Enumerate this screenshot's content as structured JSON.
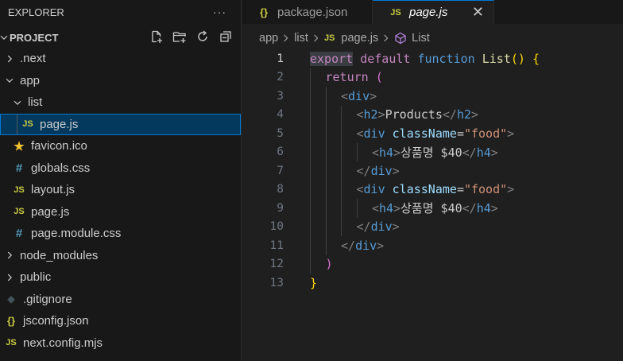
{
  "sidebar": {
    "title": "EXPLORER",
    "more": "···",
    "project": "PROJECT",
    "items": [
      {
        "label": ".next",
        "kind": "folder-closed",
        "depth": 0
      },
      {
        "label": "app",
        "kind": "folder-open",
        "depth": 0
      },
      {
        "label": "list",
        "kind": "folder-open",
        "depth": 1
      },
      {
        "label": "page.js",
        "kind": "js",
        "icon": "JS",
        "depth": 2,
        "selected": true
      },
      {
        "label": "favicon.ico",
        "kind": "star",
        "depth": 1
      },
      {
        "label": "globals.css",
        "kind": "css",
        "icon": "#",
        "depth": 1
      },
      {
        "label": "layout.js",
        "kind": "js",
        "icon": "JS",
        "depth": 1
      },
      {
        "label": "page.js",
        "kind": "js",
        "icon": "JS",
        "depth": 1
      },
      {
        "label": "page.module.css",
        "kind": "css",
        "icon": "#",
        "depth": 1
      },
      {
        "label": "node_modules",
        "kind": "folder-closed",
        "depth": 0
      },
      {
        "label": "public",
        "kind": "folder-closed",
        "depth": 0
      },
      {
        "label": ".gitignore",
        "kind": "git",
        "icon": "◆",
        "depth": 0
      },
      {
        "label": "jsconfig.json",
        "kind": "json",
        "icon": "{}",
        "depth": 0
      },
      {
        "label": "next.config.mjs",
        "kind": "js",
        "icon": "JS",
        "depth": 0
      }
    ]
  },
  "tabs": [
    {
      "label": "package.json",
      "icon": "{}",
      "active": false
    },
    {
      "label": "page.js",
      "icon": "JS",
      "active": true,
      "close": "✕"
    }
  ],
  "breadcrumb": [
    "app",
    "list",
    "page.js",
    "List"
  ],
  "breadcrumb_icons": {
    "js": "JS"
  },
  "code": {
    "line_numbers": [
      "1",
      "2",
      "3",
      "4",
      "5",
      "6",
      "7",
      "8",
      "9",
      "10",
      "11",
      "12",
      "13"
    ],
    "current_line": 1,
    "lines": [
      {
        "t": [
          [
            "k-ctl",
            "export"
          ],
          [
            "k-txt",
            " "
          ],
          [
            "k-ctl",
            "default"
          ],
          [
            "k-txt",
            " "
          ],
          [
            "k-kw",
            "function"
          ],
          [
            "k-txt",
            " "
          ],
          [
            "k-fn",
            "List"
          ],
          [
            "k-br1",
            "()"
          ],
          [
            "k-txt",
            " "
          ],
          [
            "k-br1",
            "{"
          ]
        ],
        "indent": 0
      },
      {
        "t": [
          [
            "k-ctl",
            "return"
          ],
          [
            "k-txt",
            " "
          ],
          [
            "k-br2",
            "("
          ]
        ],
        "indent": 1
      },
      {
        "t": [
          [
            "k-tag",
            "<"
          ],
          [
            "k-tn",
            "div"
          ],
          [
            "k-tag",
            ">"
          ]
        ],
        "indent": 2
      },
      {
        "t": [
          [
            "k-tag",
            "<"
          ],
          [
            "k-tn",
            "h2"
          ],
          [
            "k-tag",
            ">"
          ],
          [
            "k-txt",
            "Products"
          ],
          [
            "k-tag",
            "</"
          ],
          [
            "k-tn",
            "h2"
          ],
          [
            "k-tag",
            ">"
          ]
        ],
        "indent": 3
      },
      {
        "t": [
          [
            "k-tag",
            "<"
          ],
          [
            "k-tn",
            "div"
          ],
          [
            "k-txt",
            " "
          ],
          [
            "k-at",
            "className"
          ],
          [
            "k-txt",
            "="
          ],
          [
            "k-str",
            "\"food\""
          ],
          [
            "k-tag",
            ">"
          ]
        ],
        "indent": 3
      },
      {
        "t": [
          [
            "k-tag",
            "<"
          ],
          [
            "k-tn",
            "h4"
          ],
          [
            "k-tag",
            ">"
          ],
          [
            "k-txt",
            "상품명 $40"
          ],
          [
            "k-tag",
            "</"
          ],
          [
            "k-tn",
            "h4"
          ],
          [
            "k-tag",
            ">"
          ]
        ],
        "indent": 4
      },
      {
        "t": [
          [
            "k-tag",
            "</"
          ],
          [
            "k-tn",
            "div"
          ],
          [
            "k-tag",
            ">"
          ]
        ],
        "indent": 3
      },
      {
        "t": [
          [
            "k-tag",
            "<"
          ],
          [
            "k-tn",
            "div"
          ],
          [
            "k-txt",
            " "
          ],
          [
            "k-at",
            "className"
          ],
          [
            "k-txt",
            "="
          ],
          [
            "k-str",
            "\"food\""
          ],
          [
            "k-tag",
            ">"
          ]
        ],
        "indent": 3
      },
      {
        "t": [
          [
            "k-tag",
            "<"
          ],
          [
            "k-tn",
            "h4"
          ],
          [
            "k-tag",
            ">"
          ],
          [
            "k-txt",
            "상품명 $40"
          ],
          [
            "k-tag",
            "</"
          ],
          [
            "k-tn",
            "h4"
          ],
          [
            "k-tag",
            ">"
          ]
        ],
        "indent": 4
      },
      {
        "t": [
          [
            "k-tag",
            "</"
          ],
          [
            "k-tn",
            "div"
          ],
          [
            "k-tag",
            ">"
          ]
        ],
        "indent": 3
      },
      {
        "t": [
          [
            "k-tag",
            "</"
          ],
          [
            "k-tn",
            "div"
          ],
          [
            "k-tag",
            ">"
          ]
        ],
        "indent": 2
      },
      {
        "t": [
          [
            "k-br2",
            ")"
          ]
        ],
        "indent": 1
      },
      {
        "t": [
          [
            "k-br1",
            "}"
          ]
        ],
        "indent": 0
      }
    ]
  },
  "colors": {
    "accent": "#0078d4",
    "js_icon": "#cbcb41",
    "css_icon": "#519aba",
    "star_icon": "#f1c232"
  }
}
